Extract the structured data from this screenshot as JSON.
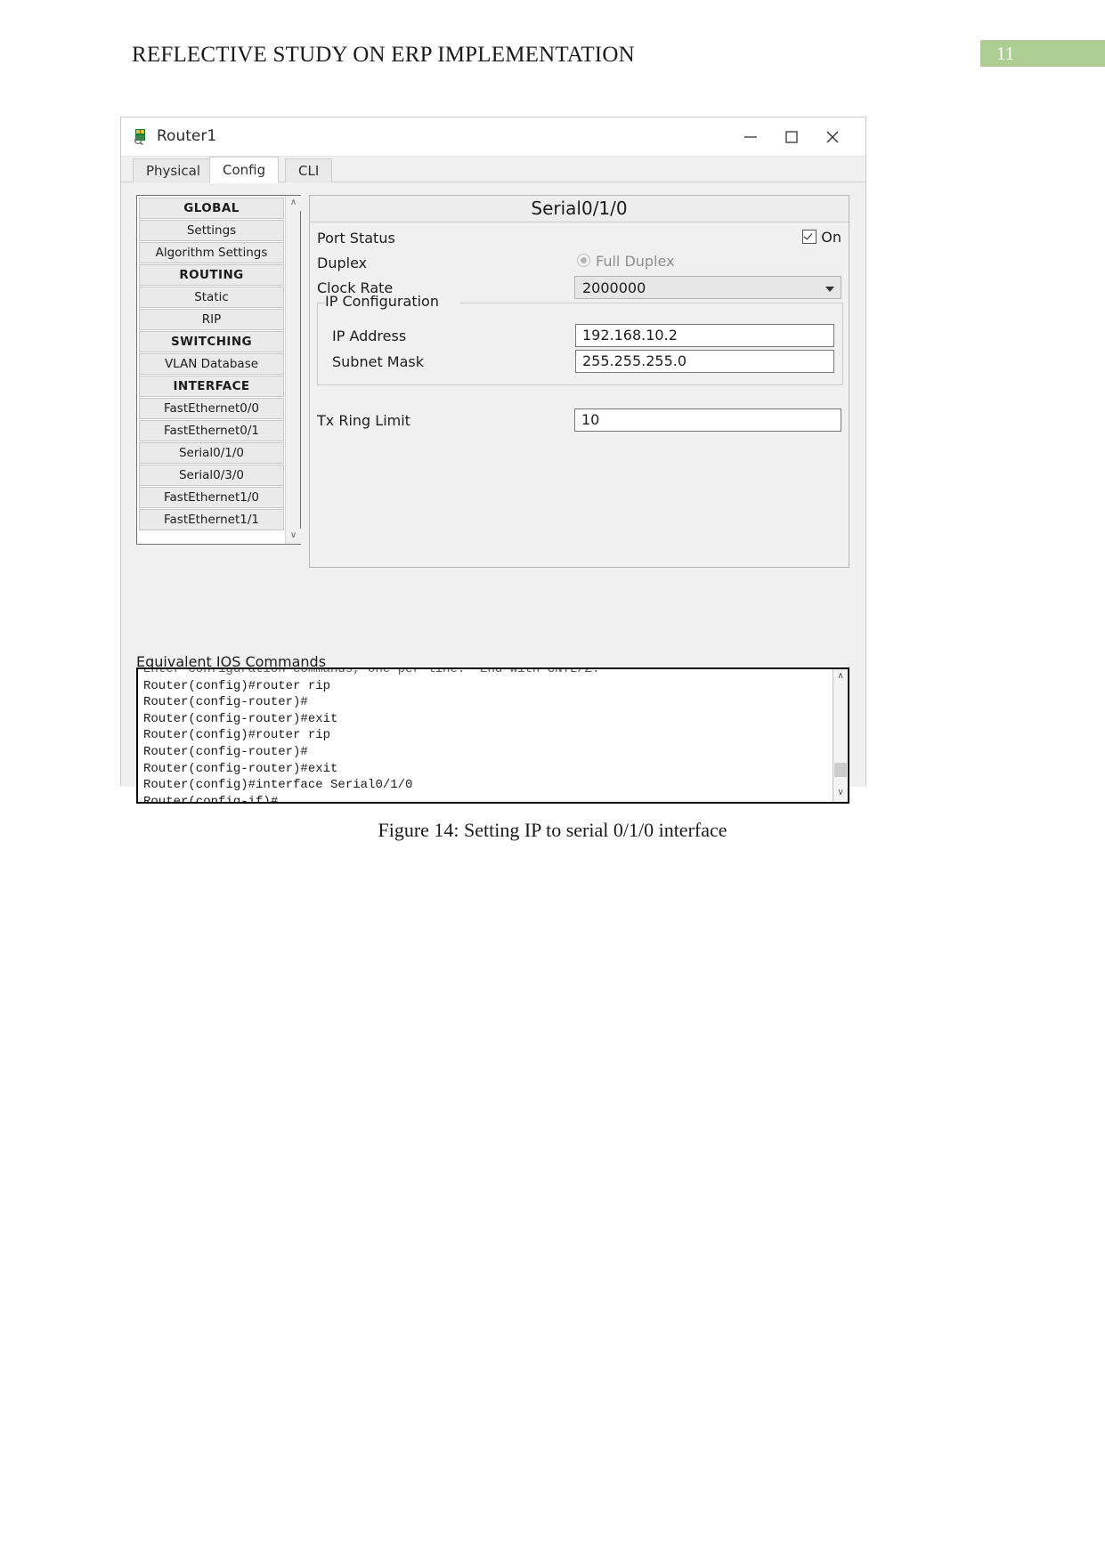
{
  "document": {
    "header_title": "REFLECTIVE STUDY ON ERP IMPLEMENTATION",
    "page_number": "11",
    "page_badge_color": "#adce93",
    "caption": "Figure 14: Setting IP to serial 0/1/0 interface"
  },
  "window": {
    "title": "Router1",
    "icon": "router-device-icon",
    "controls": {
      "minimize": "—",
      "maximize": "☐",
      "close": "✕"
    }
  },
  "tabs": [
    {
      "label": "Physical",
      "active": false
    },
    {
      "label": "Config",
      "active": true
    },
    {
      "label": "CLI",
      "active": false
    }
  ],
  "sidebar": {
    "items": [
      {
        "label": "GLOBAL",
        "type": "header"
      },
      {
        "label": "Settings",
        "type": "item"
      },
      {
        "label": "Algorithm Settings",
        "type": "item"
      },
      {
        "label": "ROUTING",
        "type": "header"
      },
      {
        "label": "Static",
        "type": "item"
      },
      {
        "label": "RIP",
        "type": "item"
      },
      {
        "label": "SWITCHING",
        "type": "header"
      },
      {
        "label": "VLAN Database",
        "type": "item"
      },
      {
        "label": "INTERFACE",
        "type": "header"
      },
      {
        "label": "FastEthernet0/0",
        "type": "item"
      },
      {
        "label": "FastEthernet0/1",
        "type": "item"
      },
      {
        "label": "Serial0/1/0",
        "type": "item"
      },
      {
        "label": "Serial0/3/0",
        "type": "item"
      },
      {
        "label": "FastEthernet1/0",
        "type": "item"
      },
      {
        "label": "FastEthernet1/1",
        "type": "item"
      }
    ],
    "scroll_up": "∧",
    "scroll_down": "∨"
  },
  "interface_panel": {
    "title": "Serial0/1/0",
    "port_status": {
      "label": "Port Status",
      "checkbox_label": "On",
      "checked": true
    },
    "duplex": {
      "label": "Duplex",
      "option_label": "Full Duplex",
      "selected": true
    },
    "clock_rate": {
      "label": "Clock Rate",
      "value": "2000000"
    },
    "ip_configuration": {
      "legend": "IP Configuration",
      "ip_address": {
        "label": "IP Address",
        "value": "192.168.10.2"
      },
      "subnet_mask": {
        "label": "Subnet Mask",
        "value": "255.255.255.0"
      }
    },
    "tx_ring_limit": {
      "label": "Tx Ring Limit",
      "value": "10"
    }
  },
  "ios_commands": {
    "label": "Equivalent IOS Commands",
    "lines": [
      "Enter configuration commands, one per line.  End with CNTL/Z.",
      "Router(config)#router rip",
      "Router(config-router)#",
      "Router(config-router)#exit",
      "Router(config)#router rip",
      "Router(config-router)#",
      "Router(config-router)#exit",
      "Router(config)#interface Serial0/1/0",
      "Router(config-if)#"
    ],
    "scroll_up": "∧",
    "scroll_down": "∨"
  }
}
